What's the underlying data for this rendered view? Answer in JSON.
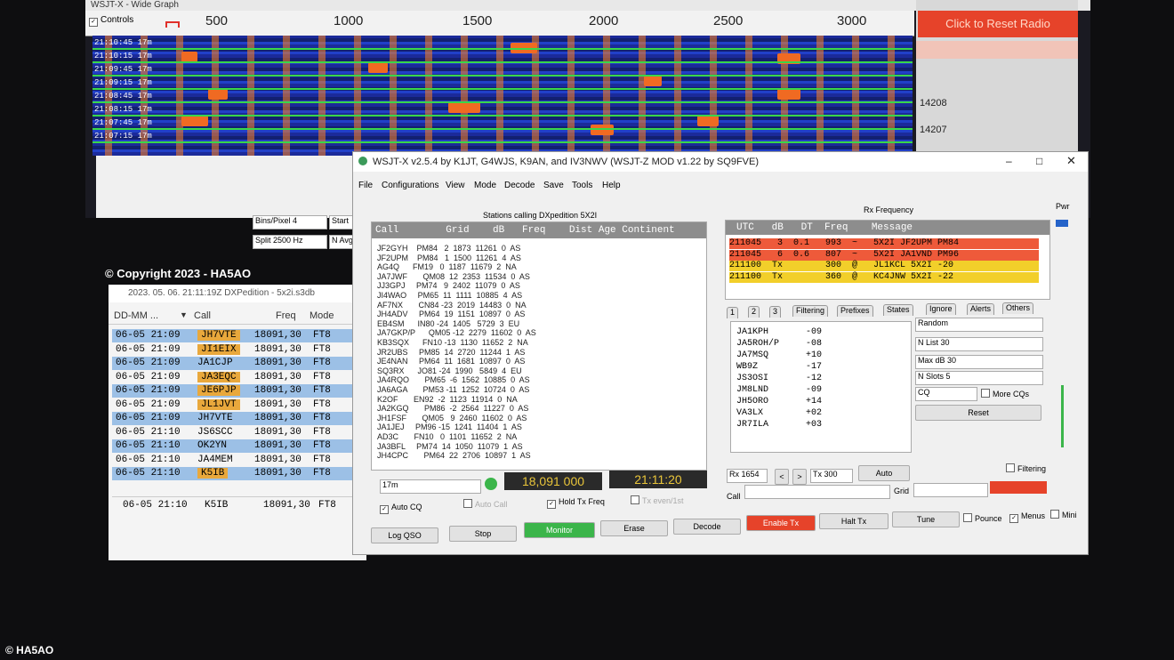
{
  "wide_graph": {
    "title": "WSJT-X - Wide Graph",
    "controls_label": "Controls",
    "freq_ticks": [
      "500",
      "1000",
      "1500",
      "2000",
      "2500",
      "3000"
    ],
    "times": [
      "21:10:45  17m",
      "21:10:15  17m",
      "21:09:45  17m",
      "21:09:15  17m",
      "21:08:45  17m",
      "21:08:15  17m",
      "21:07:45  17m",
      "21:07:15  17m"
    ],
    "bins_pixel": "Bins/Pixel  4",
    "split": "Split  2500  Hz",
    "start": "Start",
    "navg": "N Avg"
  },
  "monitor": {
    "reset_radio": "Click to Reset Radio",
    "freq1": "14208",
    "freq2": "14207"
  },
  "log": {
    "copyright": "© Copyright 2023 - HA5AO",
    "title": "2023. 05. 06. 21:11:19Z  DXPedition - 5x2i.s3db",
    "columns": [
      "DD-MM ...",
      "Call",
      "Freq",
      "Mode"
    ],
    "rows": [
      {
        "date": "06-05 21:09",
        "call": "JH7VTE",
        "freq": "18091,30",
        "mode": "FT8"
      },
      {
        "date": "06-05 21:09",
        "call": "JI1EIX",
        "freq": "18091,30",
        "mode": "FT8"
      },
      {
        "date": "06-05 21:09",
        "call": "JA1CJP",
        "freq": "18091,30",
        "mode": "FT8"
      },
      {
        "date": "06-05 21:09",
        "call": "JA3EQC",
        "freq": "18091,30",
        "mode": "FT8"
      },
      {
        "date": "06-05 21:09",
        "call": "JE6PJP",
        "freq": "18091,30",
        "mode": "FT8"
      },
      {
        "date": "06-05 21:09",
        "call": "JL1JVT",
        "freq": "18091,30",
        "mode": "FT8"
      },
      {
        "date": "06-05 21:09",
        "call": "JH7VTE",
        "freq": "18091,30",
        "mode": "FT8"
      },
      {
        "date": "06-05 21:10",
        "call": "JS6SCC",
        "freq": "18091,30",
        "mode": "FT8"
      },
      {
        "date": "06-05 21:10",
        "call": "OK2YN",
        "freq": "18091,30",
        "mode": "FT8"
      },
      {
        "date": "06-05 21:10",
        "call": "JA4MEM",
        "freq": "18091,30",
        "mode": "FT8"
      },
      {
        "date": "06-05 21:10",
        "call": "K5IB",
        "freq": "18091,30",
        "mode": "FT8"
      }
    ],
    "last_row": {
      "date": "06-05 21:10",
      "call": "K5IB",
      "freq": "18091,30",
      "mode": "FT8"
    }
  },
  "main": {
    "title": "WSJT-X   v2.5.4   by K1JT, G4WJS, K9AN, and IV3NWV (WSJT-Z MOD v1.22 by SQ9FVE)",
    "menu": [
      "File",
      "Configurations",
      "View",
      "Mode",
      "Decode",
      "Save",
      "Tools",
      "Help"
    ],
    "stations_caption": "Stations calling DXpedition 5X2I",
    "stations_header": "Call        Grid    dB   Freq    Dist Age Continent",
    "stations": [
      "JF2GYH    PM84   2  1873  11261  0  AS",
      "JF2UPM    PM84   1  1500  11261  4  AS",
      "AG4Q      FM19   0  1187  11679  2  NA",
      "JA7JWF       QM08  12  2353  11534  0  AS",
      "JJ3GPJ     PM74   9  2402  11079  0  AS",
      "JI4WAO     PM65  11  1111  10885  4  AS",
      "AF7NX       CN84 -23  2019  14483  0  NA",
      "JH4ADV     PM64  19  1151  10897  0  AS",
      "EB4SM      IN80 -24  1405   5729  3  EU",
      "JA7GKP/P      QM05 -12  2279  11602  0  AS",
      "KB3SQX      FN10 -13  1130  11652  2  NA",
      "JR2UBS     PM85  14  2720  11244  1  AS",
      "JE4NAN     PM64  11  1681  10897  0  AS",
      "SQ3RX      JO81 -24  1990   5849  4  EU",
      "JA4RQO       PM65  -6  1562  10885  0  AS",
      "JA6AGA       PM53 -11  1252  10724  0  AS",
      "K2OF       EN92  -2  1123  11914  0  NA",
      "JA2KGQ       PM86  -2  2564  11227  0  AS",
      "JH1FSF       QM05   9  2460  11602  0  AS",
      "JA1JEJ     PM96 -15  1241  11404  1  AS",
      "AD3C       FN10   0  1101  11652  2  NA",
      "JA3BFL     PM74  14  1050  11079  1  AS",
      "JH4CPC       PM64  22  2706  10897  1  AS"
    ],
    "rx_caption": "Rx Frequency",
    "rx_header": "UTC   dB   DT  Freq    Message",
    "rx_rows": [
      {
        "text": "211045   3  0.1   993  ~   5X2I JF2UPM PM84",
        "bg": "#ee5a3a"
      },
      {
        "text": "211045   6  0.6   807  ~   5X2I JA1VND PM96",
        "bg": "#ee5a3a"
      },
      {
        "text": "211100  Tx        300  @   JL1KCL 5X2I -20",
        "bg": "#f2cf2a"
      },
      {
        "text": "211100  Tx        360  @   KC4JNW 5X2I -22",
        "bg": "#f2cf2a"
      }
    ],
    "tabs": [
      "1",
      "2",
      "3",
      "Filtering",
      "Prefixes",
      "States",
      "Ignore",
      "Alerts",
      "Others"
    ],
    "callers": [
      {
        "call": "JA1KPH",
        "db": "-09"
      },
      {
        "call": "JA5ROH/P",
        "db": "-08"
      },
      {
        "call": "JA7MSQ",
        "db": "+10"
      },
      {
        "call": "WB9Z",
        "db": "-17"
      },
      {
        "call": "JS3OSI",
        "db": "-12"
      },
      {
        "call": "JM8LND",
        "db": "-09"
      },
      {
        "call": "JH5ORO",
        "db": "+14"
      },
      {
        "call": "VA3LX",
        "db": "+02"
      },
      {
        "call": "JR7ILA",
        "db": "+03"
      }
    ],
    "right_controls": {
      "random": "Random",
      "nlist": "N List   30",
      "maxdb": "Max dB  30",
      "nslots": "N Slots   5",
      "cq": "CQ",
      "more_cqs": "More CQs",
      "reset": "Reset",
      "filtering": "Filtering",
      "pwr": "Pwr"
    },
    "band": "17m",
    "dial_freq": "18,091 000",
    "utc_time": "21:11:20",
    "rx": "Rx 1654",
    "tx": "Tx 300",
    "auto": "Auto",
    "call_label": "Call",
    "grid_label": "Grid",
    "checks": {
      "auto_cq": "Auto CQ",
      "auto_call": "Auto Call",
      "hold_tx": "Hold Tx Freq",
      "tx_even": "Tx even/1st",
      "pounce": "Pounce",
      "menus": "Menus",
      "mini": "Mini"
    },
    "buttons": {
      "log_qso": "Log QSO",
      "stop": "Stop",
      "monitor": "Monitor",
      "erase": "Erase",
      "decode": "Decode",
      "enable_tx": "Enable Tx",
      "halt_tx": "Halt Tx",
      "tune": "Tune"
    }
  },
  "footer": "© HA5AO",
  "colors": {
    "accent_red": "#e6432a",
    "monitor_green": "#3bb54a",
    "log_highlight_blue": "#9cc0e6",
    "log_highlight_orange": "#e9a83c",
    "waterfall_blue": "#2140c8",
    "display_bg": "#2a2a2a",
    "display_text": "#e9c53a"
  }
}
